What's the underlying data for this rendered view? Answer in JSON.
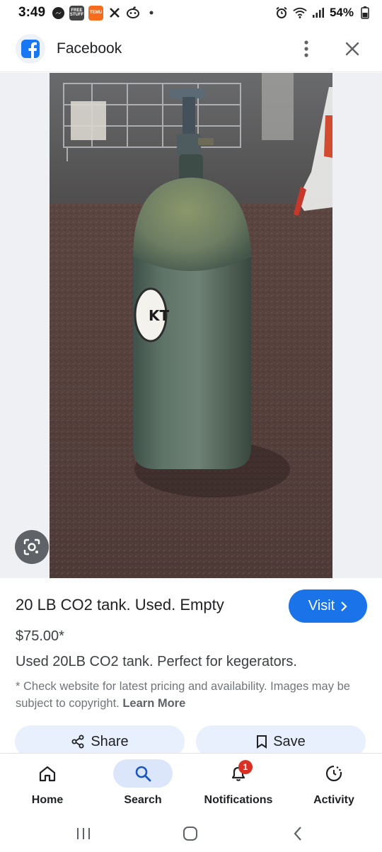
{
  "status_bar": {
    "time": "3:49",
    "notification_icons": [
      {
        "icon": "messenger-icon"
      },
      {
        "icon": "free-stuff-app-icon",
        "text": "FREE STUFF"
      },
      {
        "icon": "temu-app-icon",
        "text": "TEMU"
      },
      {
        "icon": "x-app-icon"
      },
      {
        "icon": "alien-app-icon"
      }
    ],
    "battery": "54%"
  },
  "header": {
    "title": "Facebook"
  },
  "product": {
    "title": "20 LB CO2 tank. Used. Empty",
    "visit_label": "Visit",
    "price": "$75.00*",
    "description": "Used 20LB CO2 tank. Perfect for kegerators.",
    "disclaimer": "* Check website for latest pricing and availability. Images may be subject to copyright.",
    "learn_more": "Learn More"
  },
  "actions": {
    "share_label": "Share",
    "save_label": "Save"
  },
  "bottom_nav": {
    "items": [
      {
        "label": "Home",
        "icon": "home-icon"
      },
      {
        "label": "Search",
        "icon": "search-icon",
        "active": true
      },
      {
        "label": "Notifications",
        "icon": "bell-icon",
        "badge": "1"
      },
      {
        "label": "Activity",
        "icon": "activity-icon"
      }
    ]
  },
  "colors": {
    "accent": "#1a73e8",
    "pill": "#e8f0fe",
    "badge": "#d93025",
    "facebook_blue": "#1877f2"
  }
}
